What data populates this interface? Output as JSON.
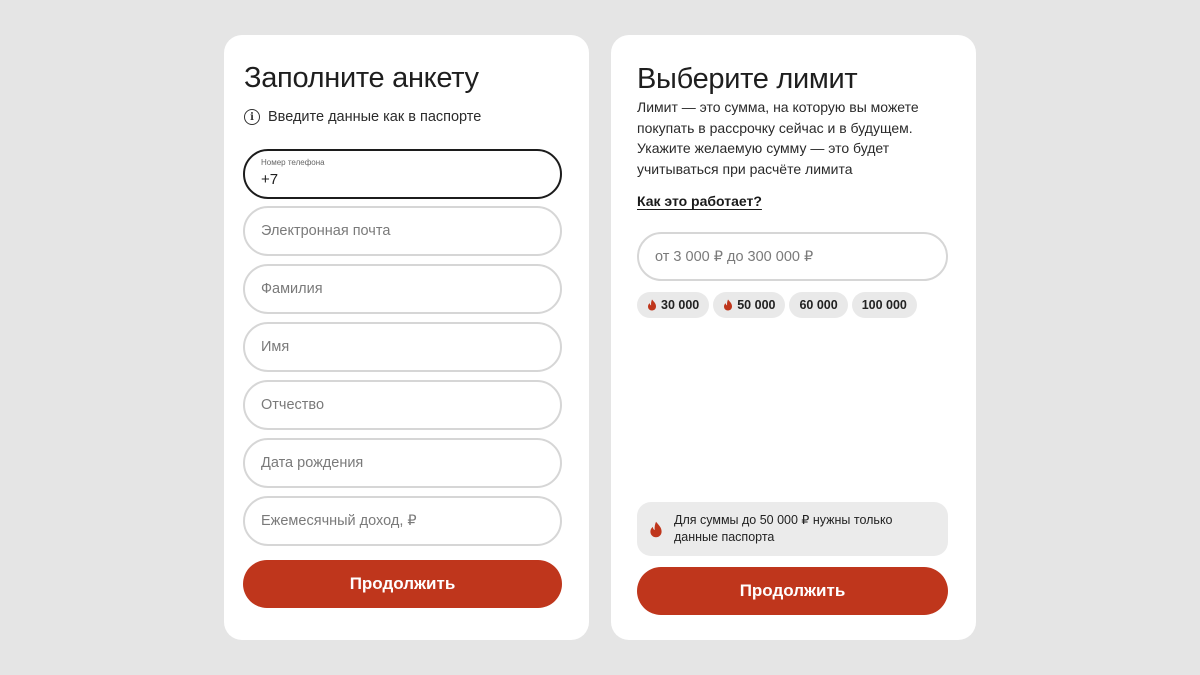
{
  "form": {
    "title": "Заполните анкету",
    "hint": "Введите данные как в паспорте",
    "phone": {
      "label": "Номер телефона",
      "value": "+7"
    },
    "fields": [
      {
        "placeholder": "Электронная почта"
      },
      {
        "placeholder": "Фамилия"
      },
      {
        "placeholder": "Имя"
      },
      {
        "placeholder": "Отчество"
      },
      {
        "placeholder": "Дата рождения"
      },
      {
        "placeholder": "Ежемесячный доход, ₽"
      }
    ],
    "continue_label": "Продолжить"
  },
  "limit": {
    "title": "Выберите лимит",
    "description": "Лимит — это сумма, на которую вы можете покупать в рассрочку сейчас и в будущем. Укажите желаемую сумму — это будет учитываться при расчёте лимита",
    "how_link": "Как это работает?",
    "input_placeholder": "от 3 000 ₽ до 300 000 ₽",
    "chips": [
      {
        "label": "30 000",
        "icon": "flame-icon"
      },
      {
        "label": "50 000",
        "icon": "flame-icon"
      },
      {
        "label": "60 000"
      },
      {
        "label": "100 000"
      }
    ],
    "notice": "Для суммы до 50 000 ₽ нужны только данные паспорта",
    "continue_label": "Продолжить"
  },
  "colors": {
    "accent": "#bf361c",
    "background": "#e5e5e5",
    "card": "#ffffff"
  }
}
